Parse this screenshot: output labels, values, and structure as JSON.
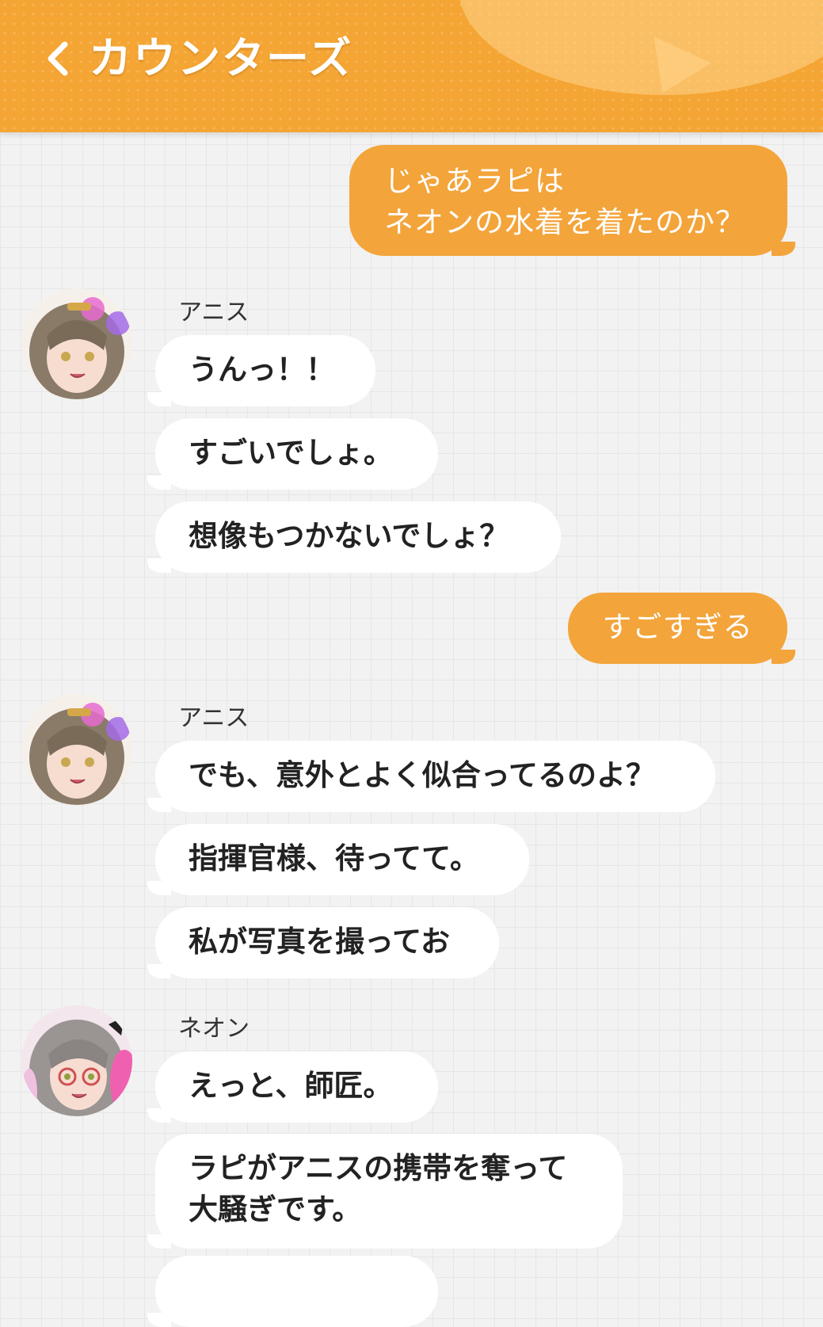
{
  "header": {
    "title": "カウンターズ"
  },
  "colors": {
    "header_bg": "#f4a534",
    "outgoing_bubble": "#f3a43a",
    "incoming_bubble": "#ffffff",
    "background": "#f2f2f2"
  },
  "icons": {
    "back": "chevron-left-icon",
    "avatar_anis": "avatar-anis",
    "avatar_neon": "avatar-neon"
  },
  "messages": [
    {
      "direction": "outgoing",
      "text": "じゃあラピは\nネオンの水着を着たのか？"
    },
    {
      "direction": "incoming",
      "sender": "アニス",
      "texts": [
        "うんっ！！",
        "すごいでしょ。",
        "想像もつかないでしょ？"
      ]
    },
    {
      "direction": "outgoing",
      "text": "すごすぎる"
    },
    {
      "direction": "incoming",
      "sender": "アニス",
      "texts": [
        "でも、意外とよく似合ってるのよ？",
        "指揮官様、待ってて。",
        "私が写真を撮ってお"
      ]
    },
    {
      "direction": "incoming",
      "sender": "ネオン",
      "texts": [
        "えっと、師匠。",
        "ラピがアニスの携帯を奪って\n大騒ぎです。"
      ]
    }
  ]
}
